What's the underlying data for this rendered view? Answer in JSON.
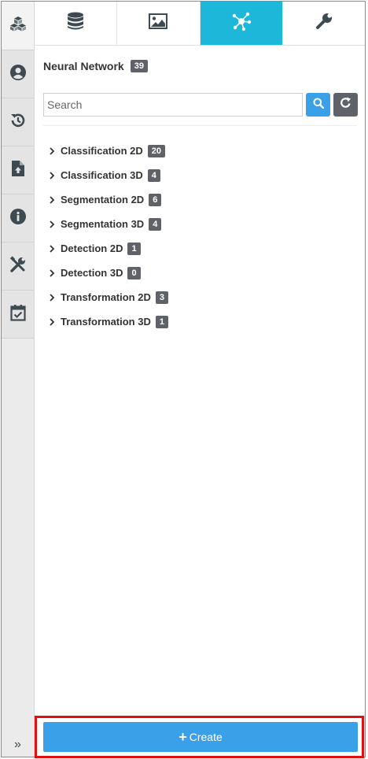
{
  "tabs": [
    {
      "icon": "database-icon",
      "active": false
    },
    {
      "icon": "image-icon",
      "active": false
    },
    {
      "icon": "network-icon",
      "active": true
    },
    {
      "icon": "wrench-icon",
      "active": false
    }
  ],
  "sidebar": {
    "items": [
      {
        "icon": "cubes-icon"
      },
      {
        "icon": "user-icon"
      },
      {
        "icon": "history-icon"
      },
      {
        "icon": "file-upload-icon"
      },
      {
        "icon": "info-icon"
      },
      {
        "icon": "tools-icon"
      },
      {
        "icon": "calendar-check-icon"
      }
    ],
    "expand_label": "»"
  },
  "panel": {
    "title": "Neural Network",
    "count": "39"
  },
  "search": {
    "placeholder": "Search"
  },
  "tree": [
    {
      "label": "Classification 2D",
      "count": "20"
    },
    {
      "label": "Classification 3D",
      "count": "4"
    },
    {
      "label": "Segmentation 2D",
      "count": "6"
    },
    {
      "label": "Segmentation 3D",
      "count": "4"
    },
    {
      "label": "Detection 2D",
      "count": "1"
    },
    {
      "label": "Detection 3D",
      "count": "0"
    },
    {
      "label": "Transformation 2D",
      "count": "3"
    },
    {
      "label": "Transformation 3D",
      "count": "1"
    }
  ],
  "create": {
    "plus": "+",
    "label": "Create"
  },
  "colors": {
    "accent_tab": "#1db8d9",
    "primary_button": "#3aa0e8",
    "badge": "#5f6369",
    "highlight": "#e01010"
  }
}
